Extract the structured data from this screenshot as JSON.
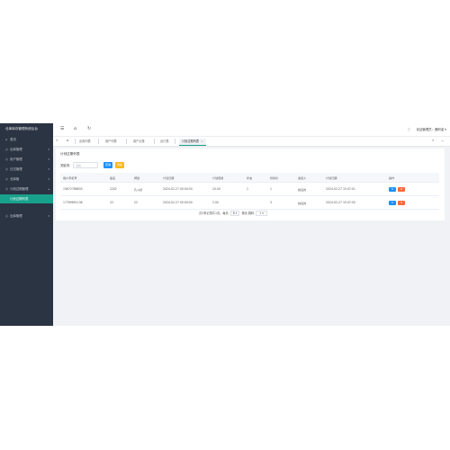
{
  "sidebar": {
    "brand": "仓库库存管理系统后台",
    "items": [
      {
        "icon": "⌂",
        "label": "首页",
        "chevron": ""
      },
      {
        "icon": "◎",
        "label": "出库管理",
        "chevron": "▾"
      },
      {
        "icon": "◎",
        "label": "用户管理",
        "chevron": "▾"
      },
      {
        "icon": "◎",
        "label": "日志管理",
        "chevron": "▾"
      },
      {
        "icon": "◎",
        "label": "仓库管",
        "chevron": "▾"
      },
      {
        "icon": "◎",
        "label": "计划过期管理",
        "chevron": "▴"
      }
    ],
    "subitem": "计划过期列表",
    "last_item": {
      "icon": "◎",
      "label": "出库管理",
      "chevron": "▾"
    }
  },
  "topbar": {
    "menu_icon": "☰",
    "home_icon": "⌂",
    "refresh_icon": "↻",
    "right_icon": "□",
    "user": "欢迎管理员：鹿阿诺 ▾"
  },
  "tabs": {
    "prev": "«",
    "home": "⌂",
    "items": [
      "出库列表",
      "用户列表",
      "用户记录",
      "出行表"
    ],
    "active": "计划过期列表",
    "close": "×",
    "next": "»",
    "more": "⌄"
  },
  "card": {
    "title": "计划过期列表",
    "search_label": "关键词：",
    "search_placeholder": "请输",
    "btn_query": "查询",
    "btn_add": "添加"
  },
  "table": {
    "headers": [
      "用户手机号",
      "船名",
      "押送",
      "计划日期",
      "计划费用",
      "状态",
      "折扣价",
      "发货人",
      "计划日期",
      "操作"
    ],
    "rows": [
      [
        "15672788833",
        "2202",
        "孔斗德",
        "2024-02-27 00:00:00",
        "20.00",
        "1",
        "1",
        "姓名的",
        "2024-02-27 15:47:01"
      ],
      [
        "17789691136",
        "22",
        "22",
        "2024-02-27 00:00:00",
        "2.00",
        "",
        "3",
        "姓名的",
        "2024-02-27 15:47:50"
      ]
    ],
    "edit_icon": "✎",
    "delete_icon": "✕"
  },
  "pager": {
    "summary": "共2条记录共1页，每页",
    "per_page": "8",
    "per_page_caret": "▾",
    "next": "第页",
    "jump_label": "跳转",
    "page": "1",
    "page_caret": "▾"
  }
}
